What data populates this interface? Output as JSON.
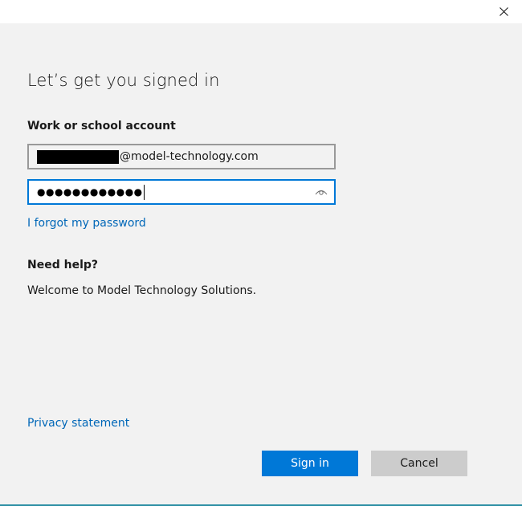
{
  "window": {
    "close_icon": "close-icon"
  },
  "heading": "Let’s get you signed in",
  "account": {
    "label": "Work or school account",
    "email_domain": "@model-technology.com",
    "password_mask": "●●●●●●●●●●●●"
  },
  "links": {
    "forgot": "I forgot my password",
    "privacy": "Privacy statement"
  },
  "help": {
    "heading": "Need help?",
    "text": "Welcome to Model Technology Solutions."
  },
  "buttons": {
    "sign_in": "Sign in",
    "cancel": "Cancel"
  },
  "colors": {
    "accent": "#0078d7",
    "link": "#0067b8",
    "background": "#f2f2f2",
    "secondary_button": "#cccccc"
  },
  "icons": {
    "reveal": "eye-icon",
    "close": "close-icon"
  }
}
